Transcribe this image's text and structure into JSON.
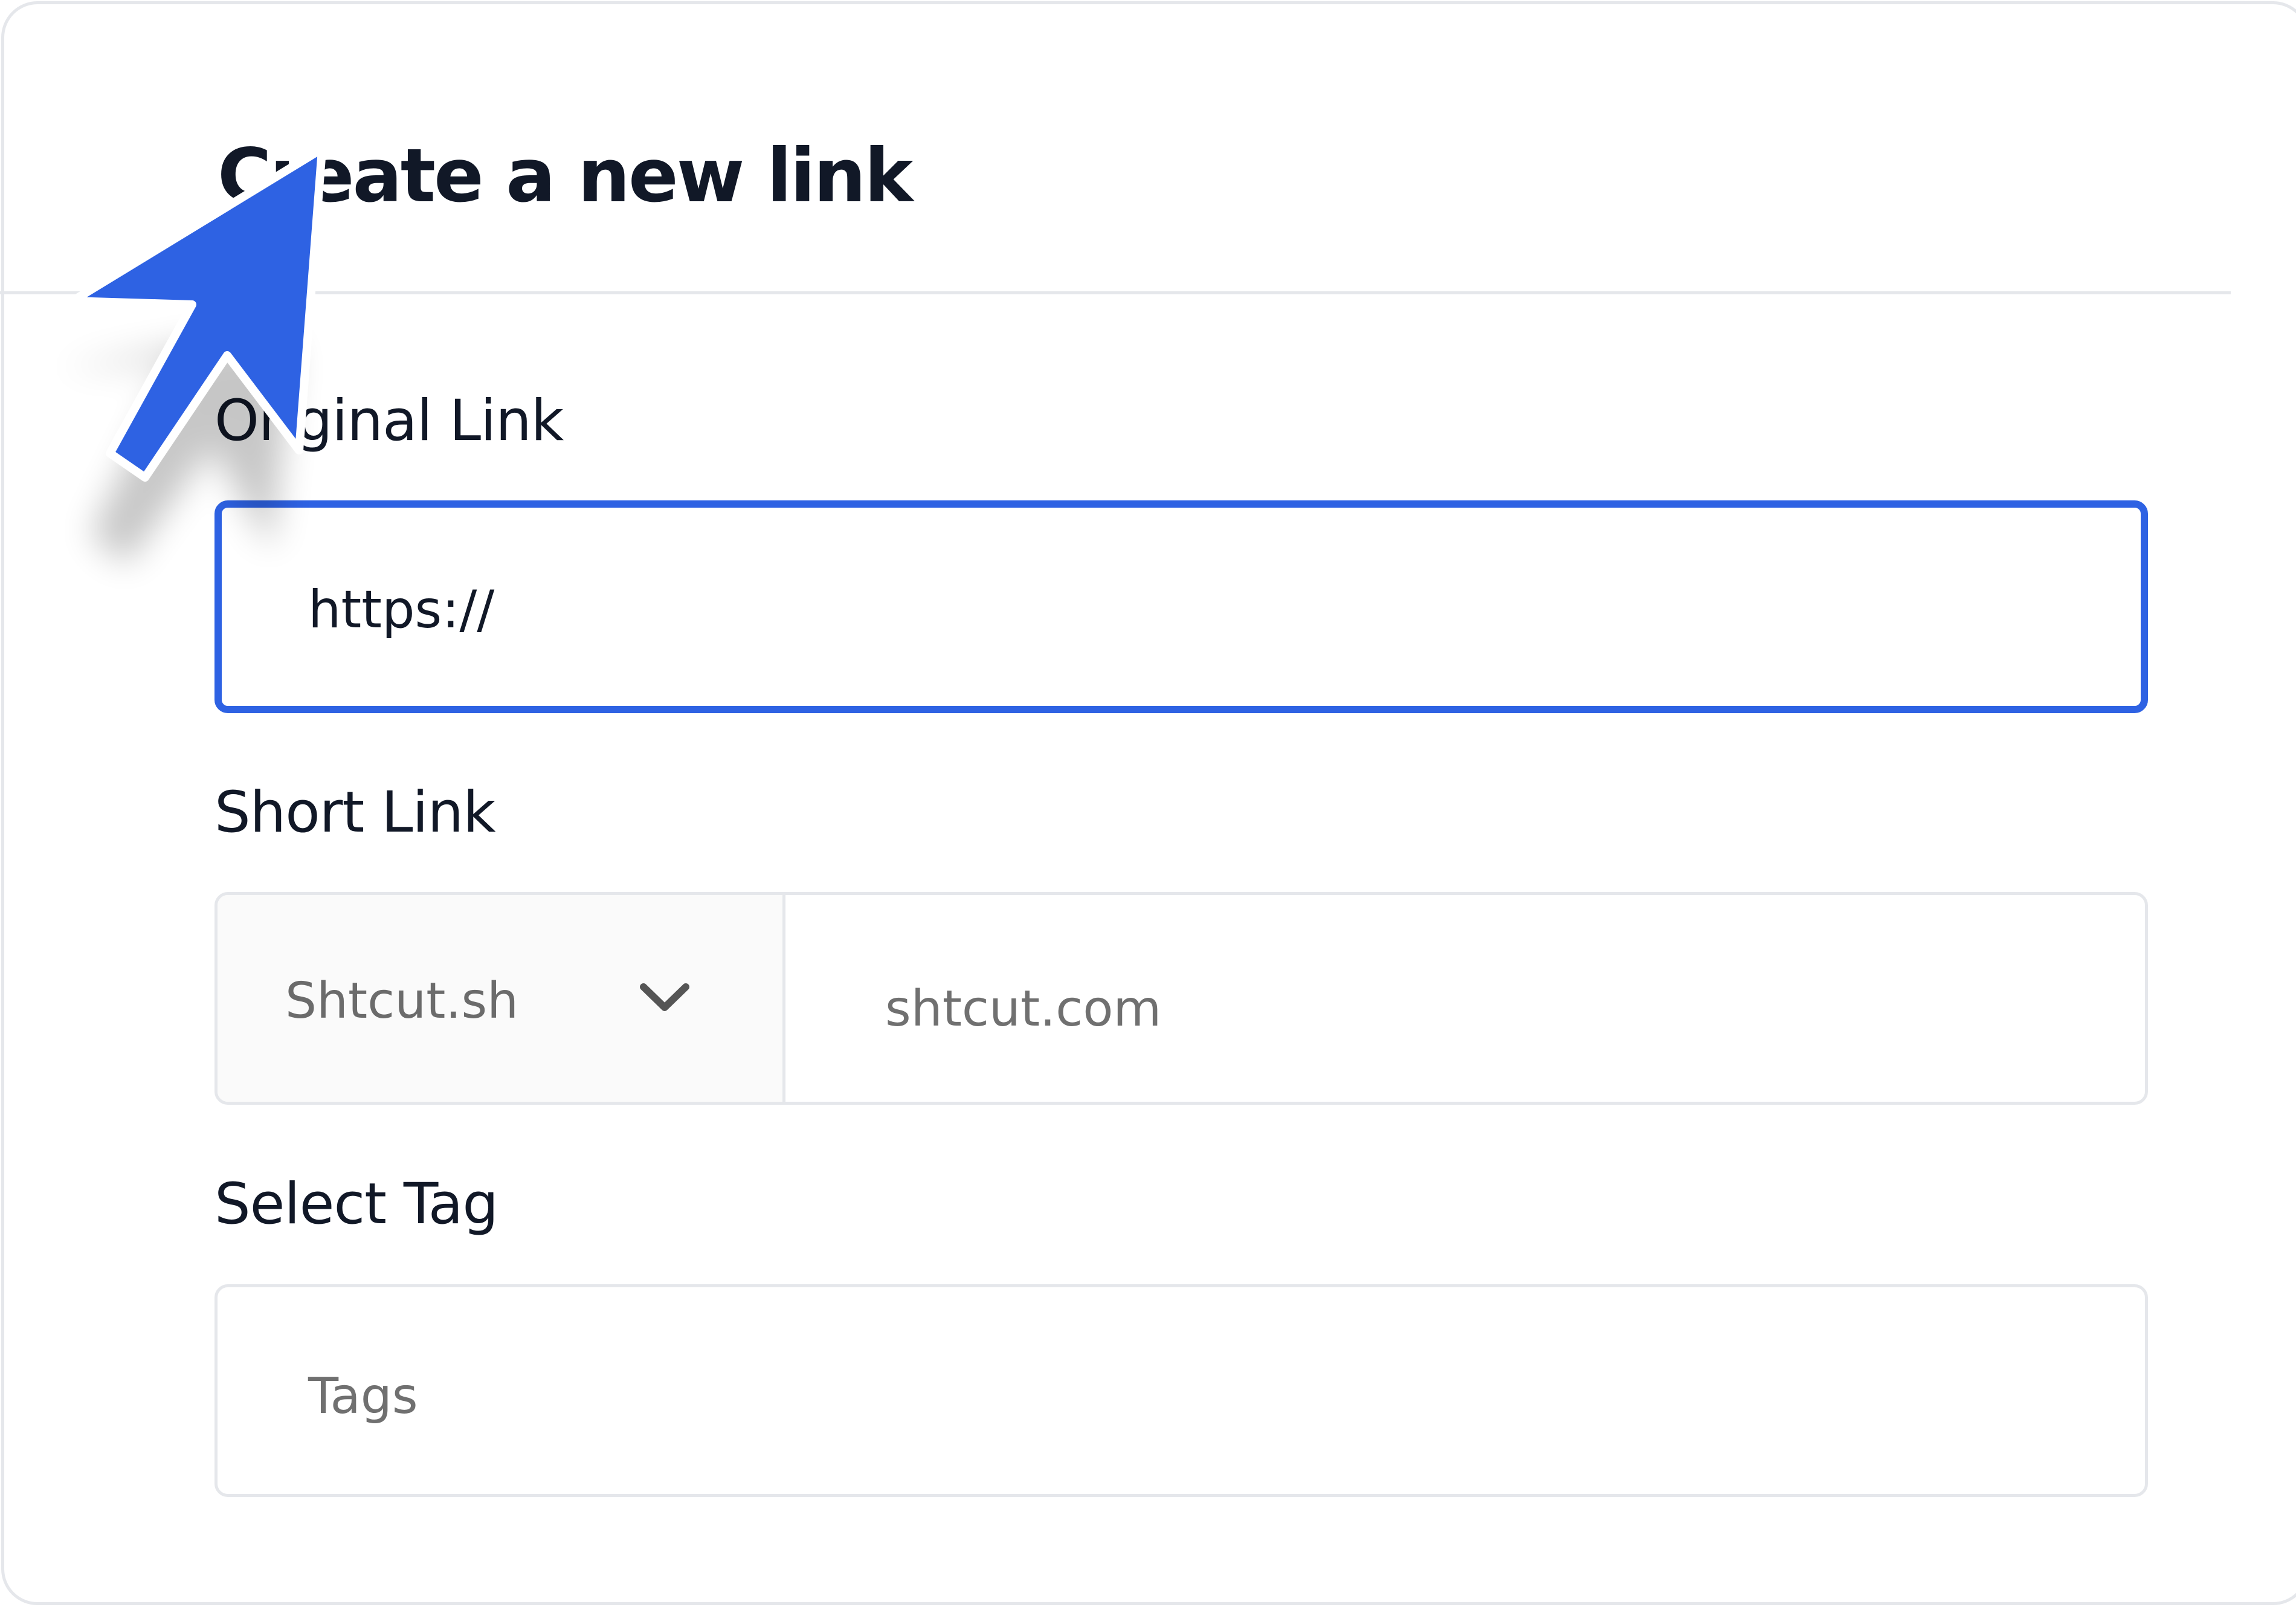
{
  "form": {
    "title": "Create  a new link",
    "original_link": {
      "label": "Original Link",
      "value": "https://"
    },
    "short_link": {
      "label": "Short Link",
      "domain_selected": "Shtcut.sh",
      "alias_placeholder": "shtcut.com"
    },
    "tag": {
      "label": "Select Tag",
      "placeholder": "Tags"
    }
  },
  "colors": {
    "accent": "#2e62e3",
    "border": "#e5e7eb",
    "text": "#111827",
    "placeholder": "#707070"
  },
  "icons": {
    "dropdown": "chevron-down-icon",
    "pointer": "mouse-cursor-icon"
  }
}
